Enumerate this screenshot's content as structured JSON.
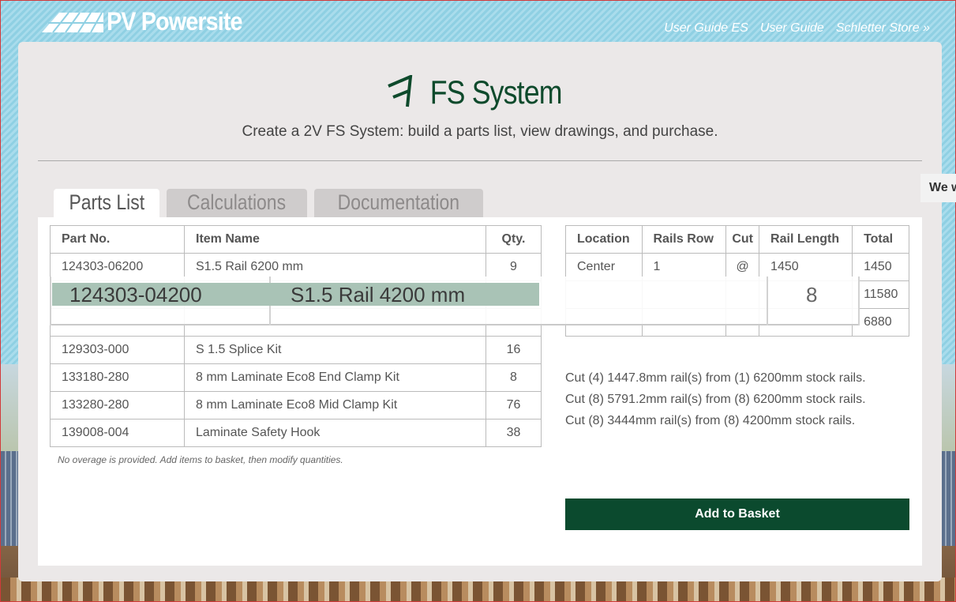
{
  "header": {
    "logo_text": "PV Powersite",
    "links": [
      "User Guide ES",
      "User Guide",
      "Schletter Store »"
    ]
  },
  "system": {
    "title": "FS System",
    "subtitle": "Create a 2V FS System: build a parts list, view drawings, and purchase."
  },
  "side_tag": "We w",
  "tabs": [
    "Parts List",
    "Calculations",
    "Documentation"
  ],
  "parts_table": {
    "headers": [
      "Part No.",
      "Item Name",
      "Qty."
    ],
    "rows": [
      {
        "part": "124303-06200",
        "name": "S1.5 Rail 6200 mm",
        "qty": "9"
      },
      {
        "part": "",
        "name": "",
        "qty": ""
      },
      {
        "part": "",
        "name": "",
        "qty": ""
      },
      {
        "part": "129303-000",
        "name": "S 1.5 Splice Kit",
        "qty": "16"
      },
      {
        "part": "133180-280",
        "name": "8 mm Laminate Eco8 End Clamp Kit",
        "qty": "8"
      },
      {
        "part": "133280-280",
        "name": "8 mm Laminate Eco8 Mid Clamp Kit",
        "qty": "76"
      },
      {
        "part": "139008-004",
        "name": "Laminate Safety Hook",
        "qty": "38"
      }
    ],
    "note": "No overage is provided. Add items to basket, then modify quantities."
  },
  "drag_row": {
    "part": "124303-04200",
    "name": "S1.5 Rail 4200 mm",
    "qty": "8"
  },
  "rails_table": {
    "headers": [
      "Location",
      "Rails Row",
      "Cut",
      "Rail Length",
      "Total"
    ],
    "rows": [
      {
        "location": "Center",
        "rails_row": "1",
        "cut": "@",
        "length": "1450",
        "total": "1450"
      },
      {
        "location": "",
        "rails_row": "",
        "cut": "",
        "length": "",
        "total": "11580"
      },
      {
        "location": "",
        "rails_row": "",
        "cut": "",
        "length": "",
        "total": "6880"
      }
    ]
  },
  "cuts": [
    "Cut (4) 1447.8mm rail(s) from (1) 6200mm stock rails.",
    "Cut (8) 5791.2mm rail(s) from (8) 6200mm stock rails.",
    "Cut (8) 3444mm rail(s) from (8) 4200mm stock rails."
  ],
  "basket_label": "Add to Basket",
  "colors": {
    "brand_green": "#0b4a2e",
    "sky": "#a9dcec"
  }
}
